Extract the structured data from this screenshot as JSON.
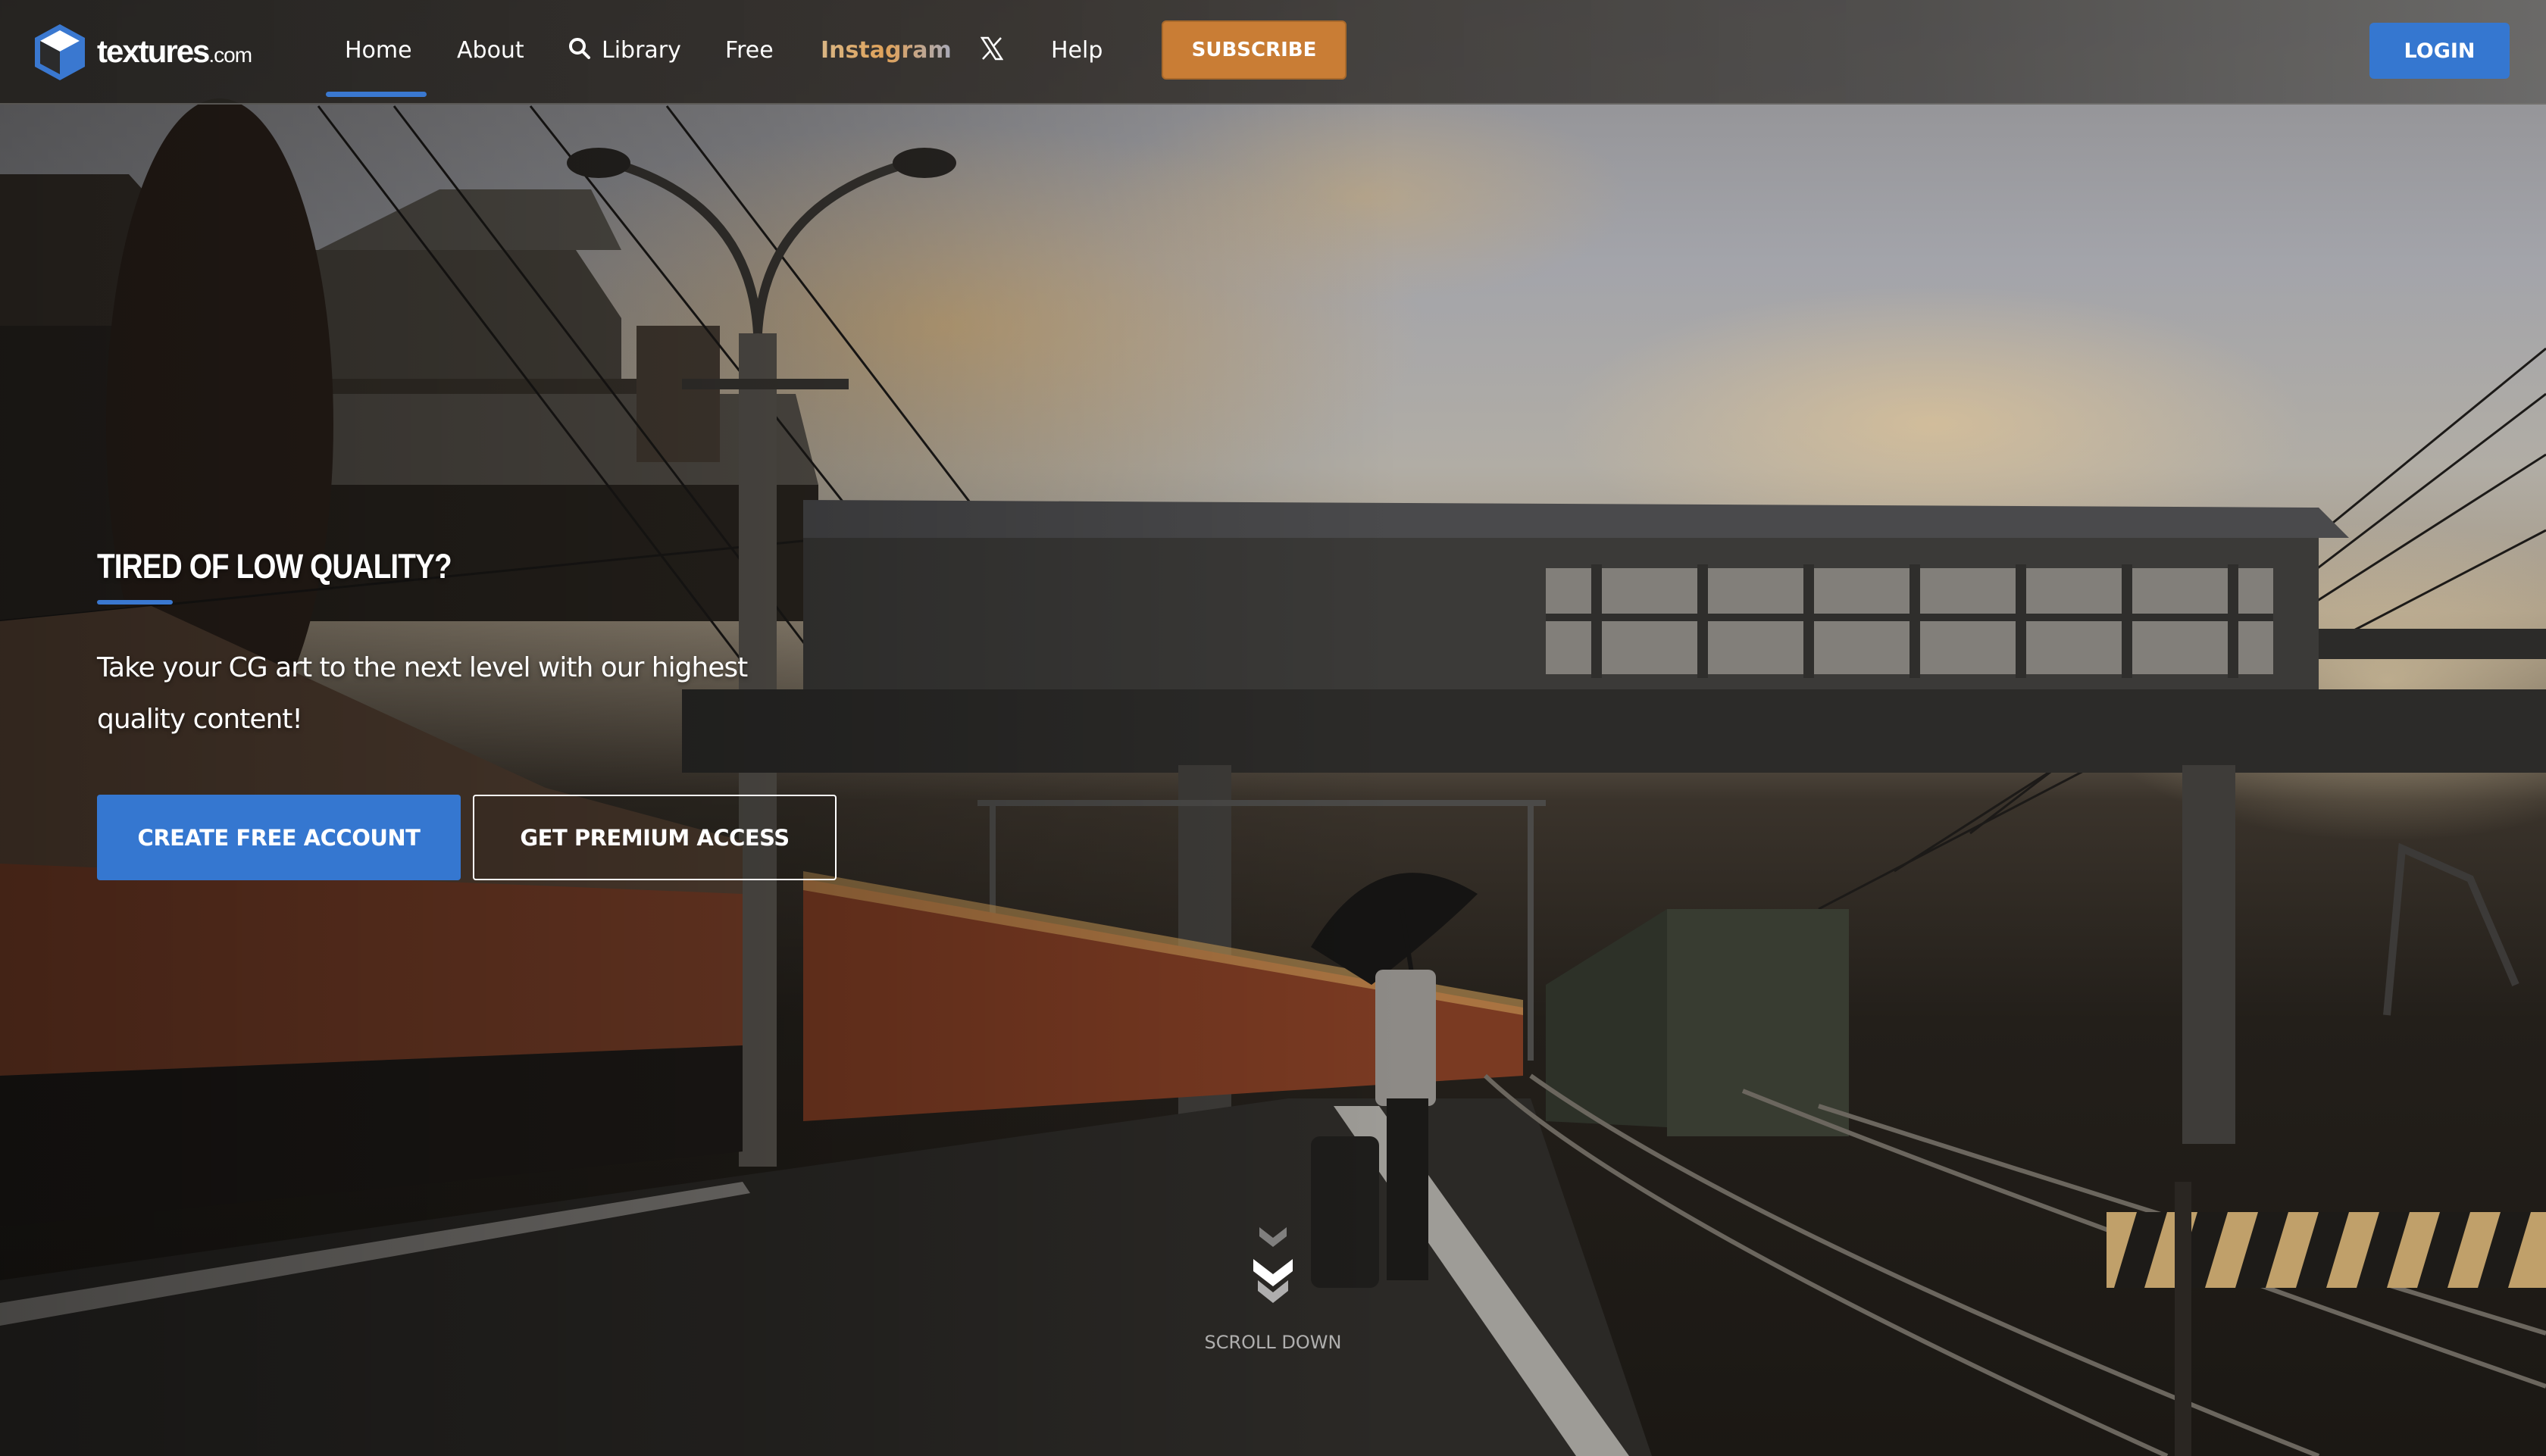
{
  "brand": {
    "name": "textures",
    "suffix": ".com"
  },
  "nav": {
    "items": [
      {
        "label": "Home",
        "active": true
      },
      {
        "label": "About"
      },
      {
        "label": "Library",
        "icon": "search-icon"
      },
      {
        "label": "Free"
      },
      {
        "label": "Instagram"
      },
      {
        "label": "",
        "icon": "x-icon"
      },
      {
        "label": "Help"
      }
    ],
    "subscribe_label": "SUBSCRIBE",
    "login_label": "LOGIN"
  },
  "hero": {
    "headline": "TIRED OF LOW QUALITY?",
    "subtext": "Take your CG art to the next level with our highest quality content!",
    "primary_cta": "CREATE FREE ACCOUNT",
    "secondary_cta": "GET PREMIUM ACCESS",
    "scroll_label": "SCROLL DOWN",
    "background_scene": "rainy railway station platform at dusk with footbridge, trains and person with umbrella"
  },
  "colors": {
    "accent_blue": "#3577d0",
    "subscribe_orange": "#c97d35",
    "text_white": "#ffffff"
  }
}
